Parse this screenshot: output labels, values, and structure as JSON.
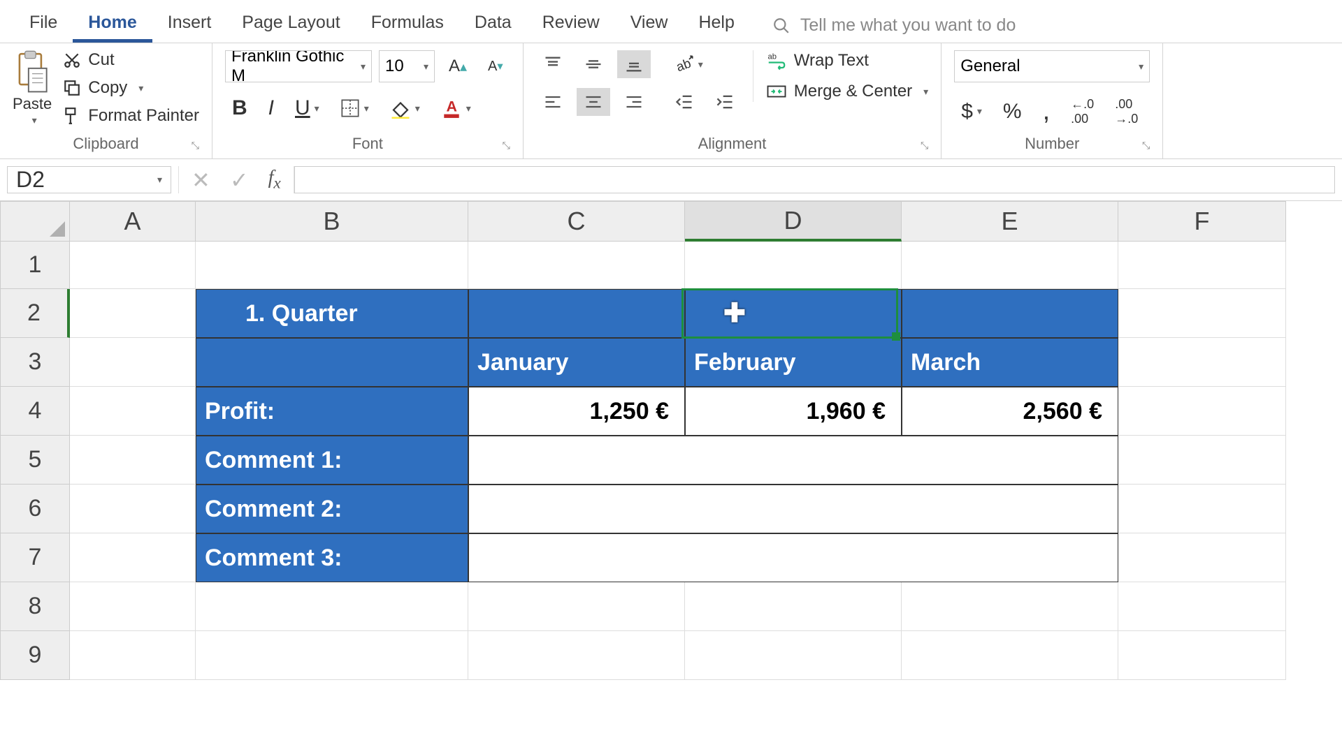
{
  "menu": {
    "items": [
      "File",
      "Home",
      "Insert",
      "Page Layout",
      "Formulas",
      "Data",
      "Review",
      "View",
      "Help"
    ],
    "active": 1,
    "tellme": "Tell me what you want to do"
  },
  "ribbon": {
    "clipboard": {
      "label": "Clipboard",
      "paste": "Paste",
      "cut": "Cut",
      "copy": "Copy",
      "format_painter": "Format Painter"
    },
    "font": {
      "label": "Font",
      "name": "Franklin Gothic M",
      "size": "10"
    },
    "alignment": {
      "label": "Alignment",
      "wrap": "Wrap Text",
      "merge": "Merge & Center"
    },
    "number": {
      "label": "Number",
      "format": "General"
    }
  },
  "namebox": "D2",
  "formula": "",
  "columns": [
    "A",
    "B",
    "C",
    "D",
    "E",
    "F"
  ],
  "rows": [
    "1",
    "2",
    "3",
    "4",
    "5",
    "6",
    "7",
    "8",
    "9"
  ],
  "cells": {
    "title": "1. Quarter",
    "months": {
      "c": "January",
      "d": "February",
      "e": "March"
    },
    "profit_label": "Profit:",
    "profit": {
      "c": "1,250 €",
      "d": "1,960 €",
      "e": "2,560 €"
    },
    "comment1": "Comment 1:",
    "comment2": "Comment 2:",
    "comment3": "Comment 3:"
  },
  "colors": {
    "header_blue": "#2f6fbf",
    "selection_green": "#1e8e3e"
  }
}
